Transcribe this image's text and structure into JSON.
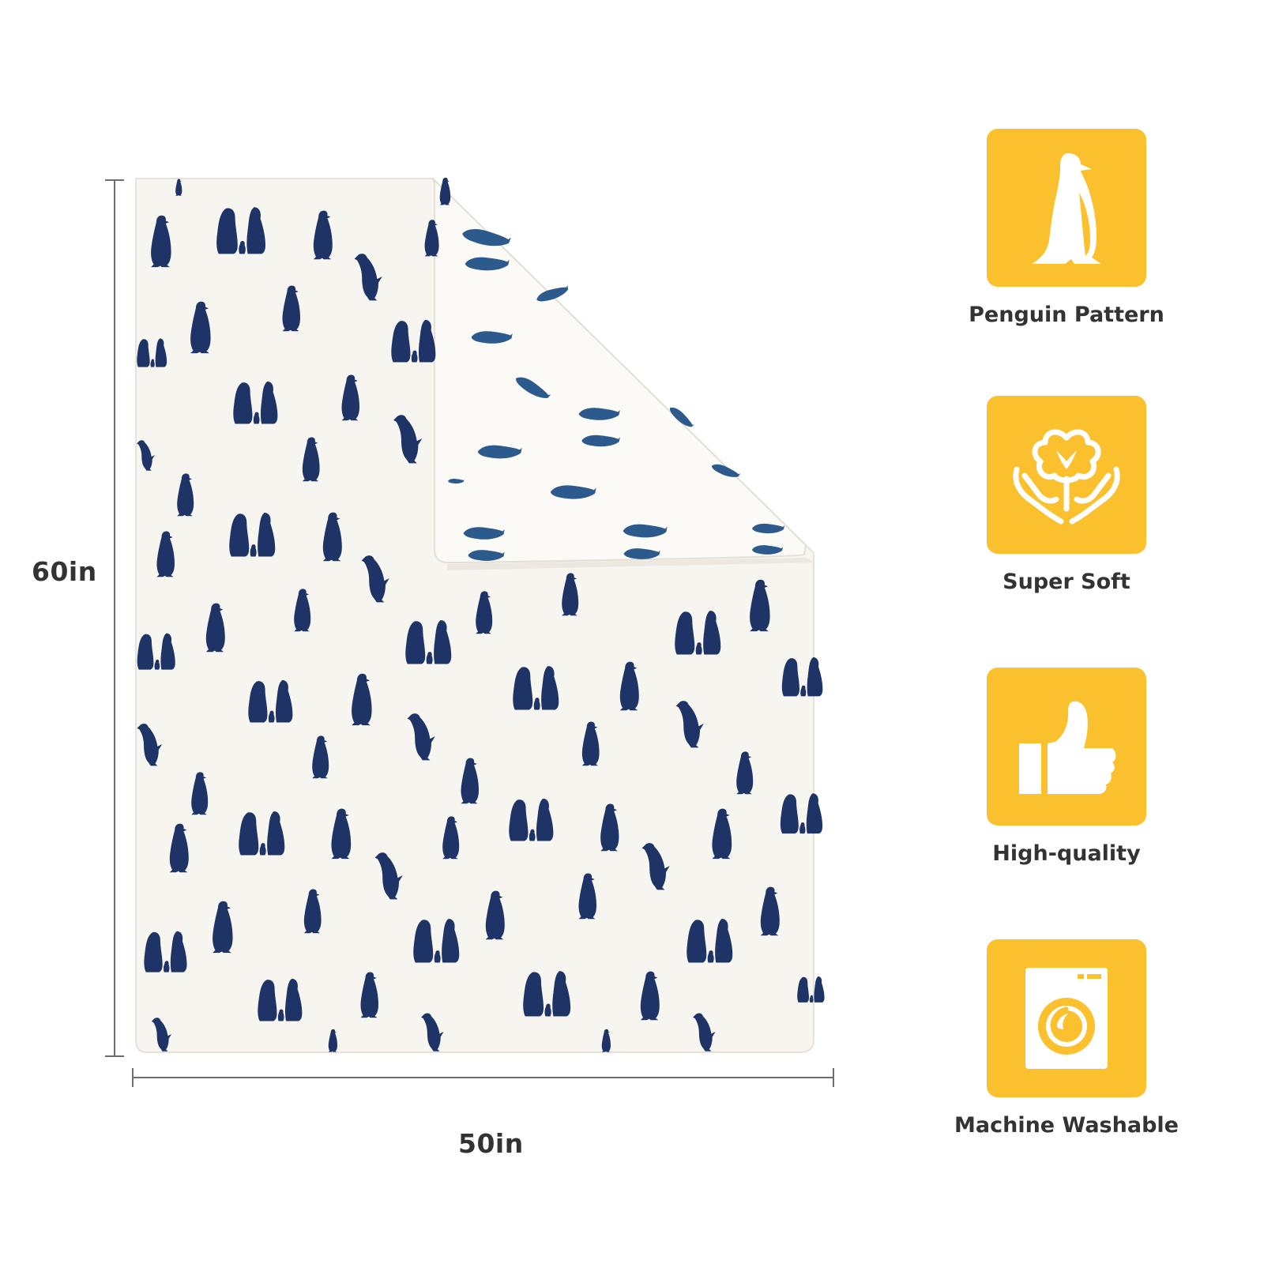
{
  "dimensions": {
    "height_label": "60in",
    "width_label": "50in"
  },
  "blanket": {
    "base_color": "#f7f5ef",
    "pattern_color": "#1f3466",
    "fold_pattern_color": "#2c5a8c",
    "pattern_icon": "penguin-icon"
  },
  "features": [
    {
      "label": "Penguin Pattern",
      "icon": "penguin-icon"
    },
    {
      "label": "Super Soft",
      "icon": "cotton-hands-icon"
    },
    {
      "label": "High-quality",
      "icon": "thumbs-up-icon"
    },
    {
      "label": "Machine Washable",
      "icon": "washing-machine-icon"
    }
  ],
  "colors": {
    "tile": "#fbc02d",
    "text": "#333333",
    "dimension_line": "#6e6e6e"
  }
}
